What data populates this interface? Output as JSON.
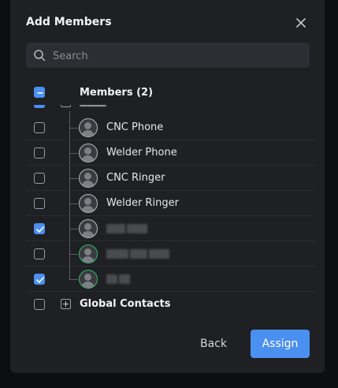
{
  "dialog": {
    "title": "Add Members",
    "close_icon": "close-icon"
  },
  "search": {
    "placeholder": "Search",
    "value": "",
    "icon": "search-icon"
  },
  "members_header": {
    "label": "Members (2)",
    "state": "indeterminate"
  },
  "tree_items": [
    {
      "label": "CNC Phone",
      "checked": false,
      "online": false,
      "redacted": false
    },
    {
      "label": "Welder Phone",
      "checked": false,
      "online": false,
      "redacted": false
    },
    {
      "label": "CNC Ringer",
      "checked": false,
      "online": false,
      "redacted": false
    },
    {
      "label": "Welder Ringer",
      "checked": false,
      "online": false,
      "redacted": false
    },
    {
      "label": "",
      "checked": true,
      "online": false,
      "redacted": true
    },
    {
      "label": "",
      "checked": false,
      "online": true,
      "redacted": true
    },
    {
      "label": "",
      "checked": true,
      "online": true,
      "redacted": true
    }
  ],
  "global_contacts": {
    "label": "Global Contacts",
    "checked": false
  },
  "footer": {
    "back_label": "Back",
    "assign_label": "Assign"
  },
  "colors": {
    "accent": "#4a90f0",
    "online": "#36b86a",
    "surface": "#1f2024"
  }
}
